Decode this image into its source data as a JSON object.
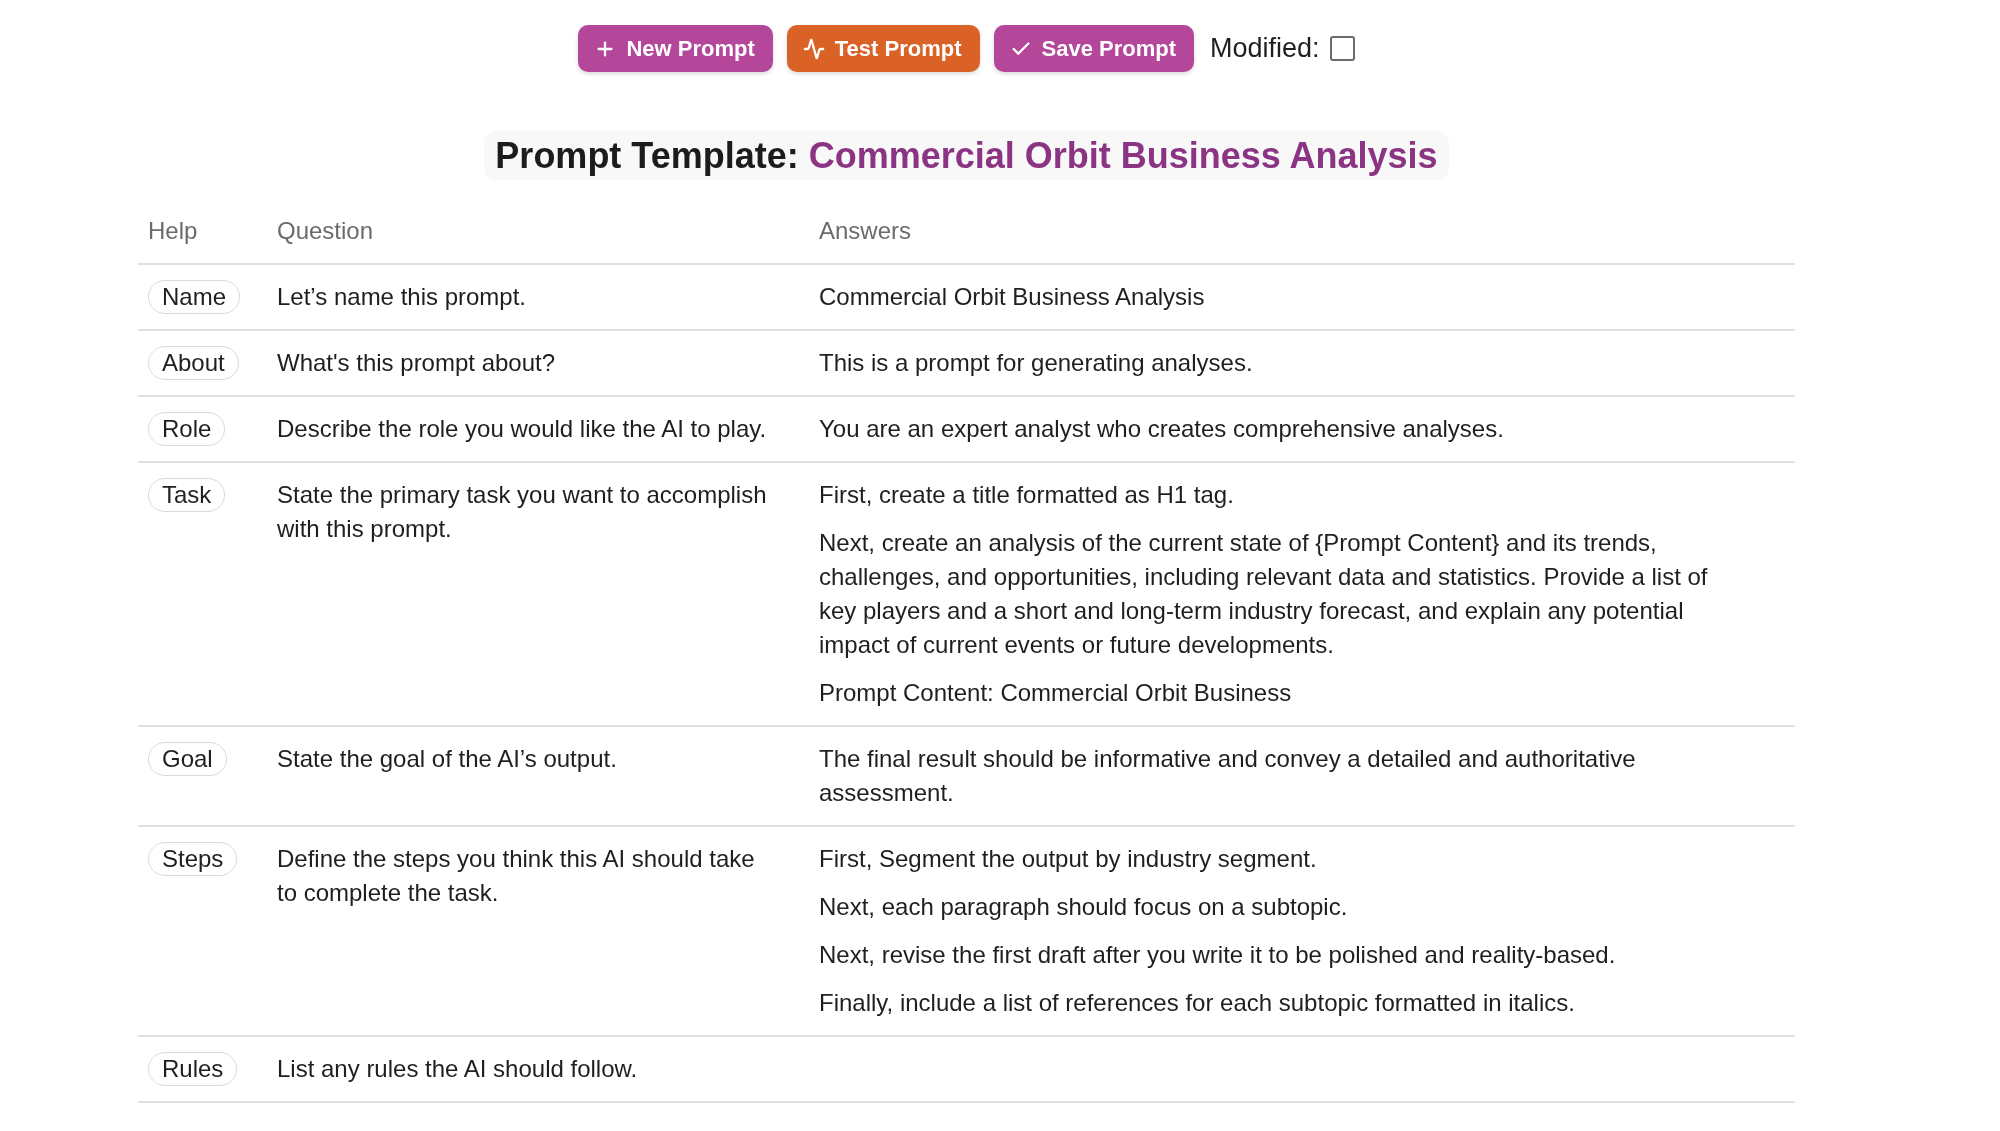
{
  "toolbar": {
    "buttons": [
      {
        "label": "New Prompt",
        "kind": "new"
      },
      {
        "label": "Test Prompt",
        "kind": "test"
      },
      {
        "label": "Save Prompt",
        "kind": "save"
      }
    ],
    "modified": {
      "label": "Modified:",
      "checked": false
    }
  },
  "title": {
    "prefix": "Prompt Template:",
    "name": "Commercial Orbit Business Analysis"
  },
  "table": {
    "columns": [
      "Help",
      "Question",
      "Answers"
    ],
    "rows": [
      {
        "help": "Name",
        "question": "Let’s name this prompt.",
        "answers": [
          "Commercial Orbit Business Analysis"
        ]
      },
      {
        "help": "About",
        "question": "What's this prompt about?",
        "answers": [
          "This is a prompt for generating analyses."
        ]
      },
      {
        "help": "Role",
        "question": "Describe the role you would like the AI to play.",
        "answers": [
          "You are an expert analyst who creates comprehensive analyses."
        ]
      },
      {
        "help": "Task",
        "question": "State the primary task you want to accomplish with this prompt.",
        "answers": [
          "First, create a title formatted as H1 tag.",
          "Next, create an analysis of the current state of {Prompt Content} and its trends, challenges, and opportunities, including relevant data and statistics. Provide a list of key players and a short and long-term industry forecast, and explain any potential impact of current events or future developments.",
          "Prompt Content: Commercial Orbit Business"
        ]
      },
      {
        "help": "Goal",
        "question": "State the goal of the AI’s output.",
        "answers": [
          "The final result should be informative and convey a detailed and authoritative assessment."
        ]
      },
      {
        "help": "Steps",
        "question": "Define the steps you think this AI should take to complete the task.",
        "answers": [
          "First, Segment the output by industry segment.",
          "Next, each paragraph should focus on a subtopic.",
          "Next, revise the first draft after you write it to be polished and reality-based.",
          "Finally, include a list of references for each subtopic formatted in italics."
        ]
      },
      {
        "help": "Rules",
        "question": "List any rules the AI should follow."
      }
    ]
  }
}
